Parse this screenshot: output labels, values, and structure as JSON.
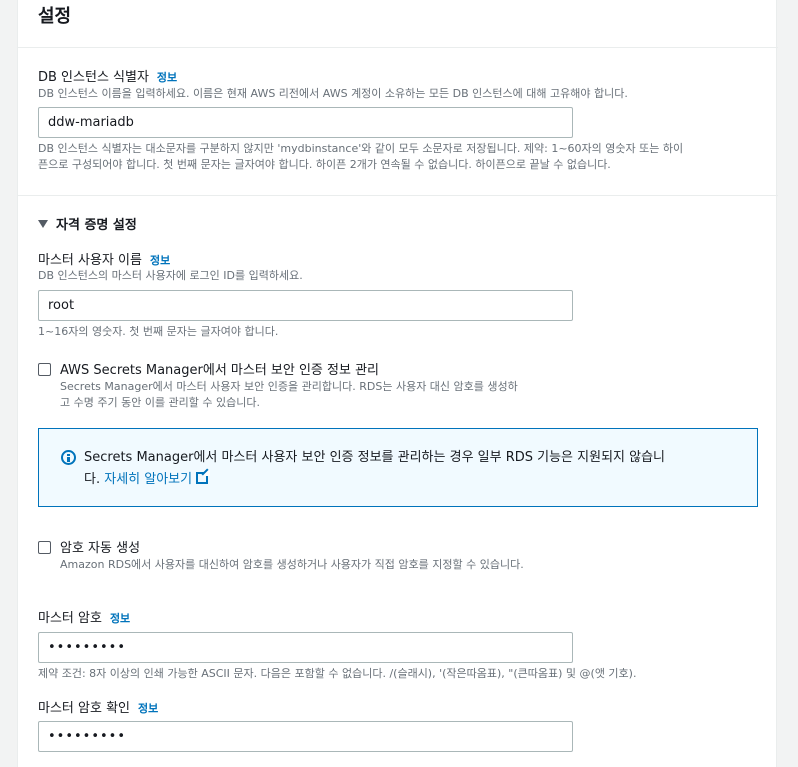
{
  "panel": {
    "title": "설정"
  },
  "db_identifier": {
    "label": "DB 인스턴스 식별자",
    "info": "정보",
    "description": "DB 인스턴스 이름을 입력하세요. 이름은 현재 AWS 리전에서 AWS 계정이 소유하는 모든 DB 인스턴스에 대해 고유해야 합니다.",
    "value": "ddw-mariadb",
    "constraint_line1": "DB 인스턴스 식별자는 대소문자를 구분하지 않지만 'mydbinstance'와 같이 모두 소문자로 저장됩니다. 제약: 1~60자의 영숫자 또는 하이",
    "constraint_line2": "픈으로 구성되어야 합니다. 첫 번째 문자는 글자여야 합니다. 하이픈 2개가 연속될 수 없습니다. 하이픈으로 끝날 수 없습니다."
  },
  "credentials": {
    "section_title": "자격 증명 설정",
    "master_username": {
      "label": "마스터 사용자 이름",
      "info": "정보",
      "description": "DB 인스턴스의 마스터 사용자에 로그인 ID를 입력하세요.",
      "value": "root",
      "constraint": "1~16자의 영숫자. 첫 번째 문자는 글자여야 합니다."
    },
    "secrets_manager": {
      "label": "AWS Secrets Manager에서 마스터 보안 인증 정보 관리",
      "description_line1": "Secrets Manager에서 마스터 사용자 보안 인증을 관리합니다. RDS는 사용자 대신 암호를 생성하",
      "description_line2": "고 수명 주기 동안 이를 관리할 수 있습니다.",
      "checked": false
    },
    "alert": {
      "text_line1": "Secrets Manager에서 마스터 사용자 보안 인증 정보를 관리하는 경우 일부 RDS 기능은 지원되지 않습니",
      "text_line2_prefix": "다.",
      "link": "자세히 알아보기"
    },
    "auto_password": {
      "label": "암호 자동 생성",
      "description": "Amazon RDS에서 사용자를 대신하여 암호를 생성하거나 사용자가 직접 암호를 지정할 수 있습니다.",
      "checked": false
    },
    "master_password": {
      "label": "마스터 암호",
      "info": "정보",
      "value": "•••••••••",
      "constraint": "제약 조건: 8자 이상의 인쇄 가능한 ASCII 문자. 다음은 포함할 수 없습니다. /(슬래시), '(작은따옴표), \"(큰따옴표) 및 @(앳 기호)."
    },
    "confirm_password": {
      "label": "마스터 암호 확인",
      "info": "정보",
      "value": "•••••••••"
    }
  }
}
